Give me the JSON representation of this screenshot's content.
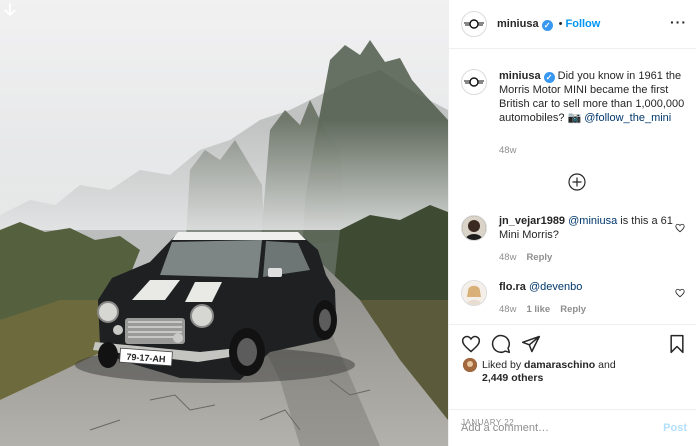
{
  "post": {
    "username": "miniusa",
    "follow_label": "Follow",
    "separator": "•",
    "verified_glyph": "✓"
  },
  "photo": {
    "license_plate": "79-17-AH",
    "download_icon": "arrow-down-icon"
  },
  "caption": {
    "username": "miniusa",
    "text": "Did you know in 1961 the Morris Motor MINI became the first British car to sell more than 1,000,000 automobiles? 📷",
    "mention": "@follow_the_mini",
    "time": "48w"
  },
  "load_more_icon": "plus-circle-icon",
  "comments": [
    {
      "username": "jn_vejar1989",
      "mention": "@miniusa",
      "text": "is this a 61 Mini Morris?",
      "time": "48w",
      "likes": "",
      "reply_label": "Reply"
    },
    {
      "username": "flo.ra",
      "mention": "@devenbo",
      "text": "",
      "time": "48w",
      "likes": "1 like",
      "reply_label": "Reply"
    }
  ],
  "actions": {
    "like_icon": "heart-icon",
    "comment_icon": "comment-icon",
    "share_icon": "paper-plane-icon",
    "save_icon": "bookmark-icon"
  },
  "likes": {
    "prefix": "Liked by",
    "user": "damaraschino",
    "connector": "and",
    "count": "2,449 others"
  },
  "date": "JANUARY 22",
  "add_comment": {
    "placeholder": "Add a comment…",
    "post_label": "Post"
  },
  "colors": {
    "accent": "#0095f6",
    "verified": "#3897f0",
    "post_disabled": "#b2dffc",
    "muted": "#8e8e8e"
  }
}
